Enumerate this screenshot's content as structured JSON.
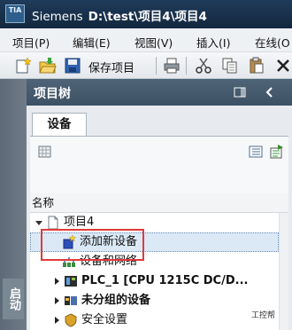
{
  "titlebar": {
    "logo": "TIA",
    "app_name": "Siemens",
    "path": "D:\\test\\项目4\\项目4"
  },
  "menu": [
    {
      "label": "项目(P)"
    },
    {
      "label": "编辑(E)"
    },
    {
      "label": "视图(V)"
    },
    {
      "label": "插入(I)"
    },
    {
      "label": "在线(O"
    }
  ],
  "toolbar": {
    "save_label": "保存项目",
    "icons": [
      "new-project-icon",
      "open-project-icon",
      "save-icon",
      "print-icon",
      "cut-icon",
      "copy-icon",
      "paste-icon",
      "delete-icon"
    ]
  },
  "side_strip": {
    "tab_label": "启动"
  },
  "panel": {
    "title": "项目树",
    "tab_label": "设备",
    "column_header": "名称",
    "tree": [
      {
        "label": "项目4",
        "icon": "project-icon",
        "expander": "expanded"
      },
      {
        "label": "添加新设备",
        "icon": "add-new-device-icon",
        "selected": true
      },
      {
        "label": "设备和网络",
        "icon": "devices-networks-icon"
      },
      {
        "label": "PLC_1 [CPU 1215C DC/D...",
        "icon": "plc-icon",
        "expander": "collapsed",
        "bold": true
      },
      {
        "label": "未分组的设备",
        "icon": "ungrouped-devices-icon",
        "expander": "collapsed",
        "bold": true
      },
      {
        "label": "安全设置",
        "icon": "security-settings-icon",
        "expander": "collapsed"
      }
    ]
  },
  "watermark": "工控帮",
  "colors": {
    "highlight": "#e03b3b",
    "header_bg": "#3d5164",
    "title_bg": "#1f3a5a",
    "selection": "#dbe9f7"
  }
}
